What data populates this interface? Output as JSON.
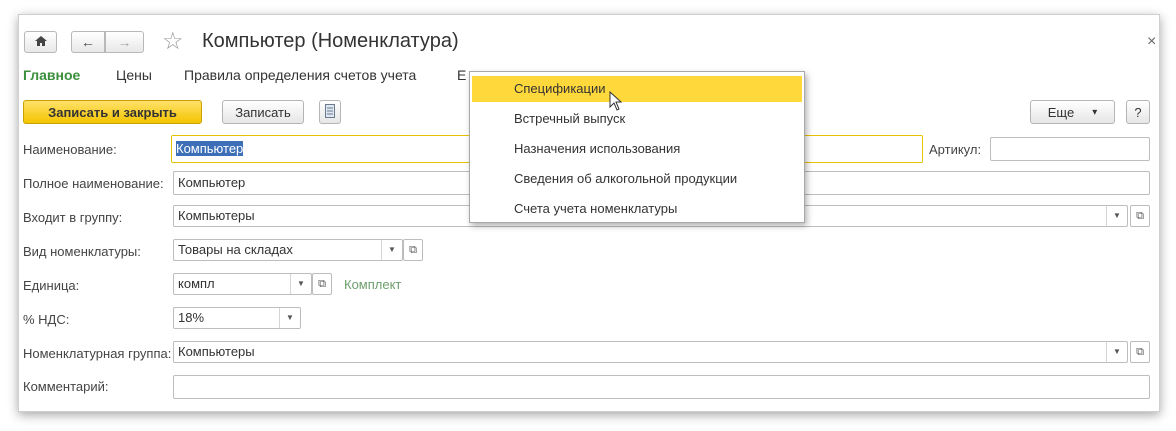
{
  "window": {
    "title": "Компьютер (Номенклатура)",
    "close_glyph": "×"
  },
  "nav": {
    "home_glyph": "⌂",
    "back_glyph": "←",
    "forward_glyph": "→",
    "star_glyph": "☆"
  },
  "tabs": [
    {
      "label": "Главное",
      "active": true
    },
    {
      "label": "Цены"
    },
    {
      "label": "Правила определения счетов учета"
    },
    {
      "label": "Е"
    }
  ],
  "toolbar": {
    "save_close_label": "Записать и закрыть",
    "save_label": "Записать",
    "more_label": "Еще",
    "more_arrow": "▾",
    "help_label": "?"
  },
  "form": {
    "name_label": "Наименование:",
    "name_value": "Компьютер",
    "article_label": "Артикул:",
    "article_value": "",
    "fullname_label": "Полное наименование:",
    "fullname_value": "Компьютер",
    "group_label": "Входит в группу:",
    "group_value": "Компьютеры",
    "kind_label": "Вид номенклатуры:",
    "kind_value": "Товары на складах",
    "unit_label": "Единица:",
    "unit_value": "компл",
    "unit_hint": "Комплект",
    "vat_label": "% НДС:",
    "vat_value": "18%",
    "nomgroup_label": "Номенклатурная группа:",
    "nomgroup_value": "Компьютеры",
    "comment_label": "Комментарий:",
    "comment_value": ""
  },
  "menu": {
    "items": [
      {
        "label": "Спецификации",
        "highlighted": true
      },
      {
        "label": "Встречный выпуск"
      },
      {
        "label": "Назначения использования"
      },
      {
        "label": "Сведения об алкогольной продукции"
      },
      {
        "label": "Счета учета номенклатуры"
      }
    ]
  },
  "colors": {
    "accent_yellow": "#f4c400",
    "active_tab_green": "#3a8f3a",
    "selection_blue": "#3d6fb8"
  }
}
